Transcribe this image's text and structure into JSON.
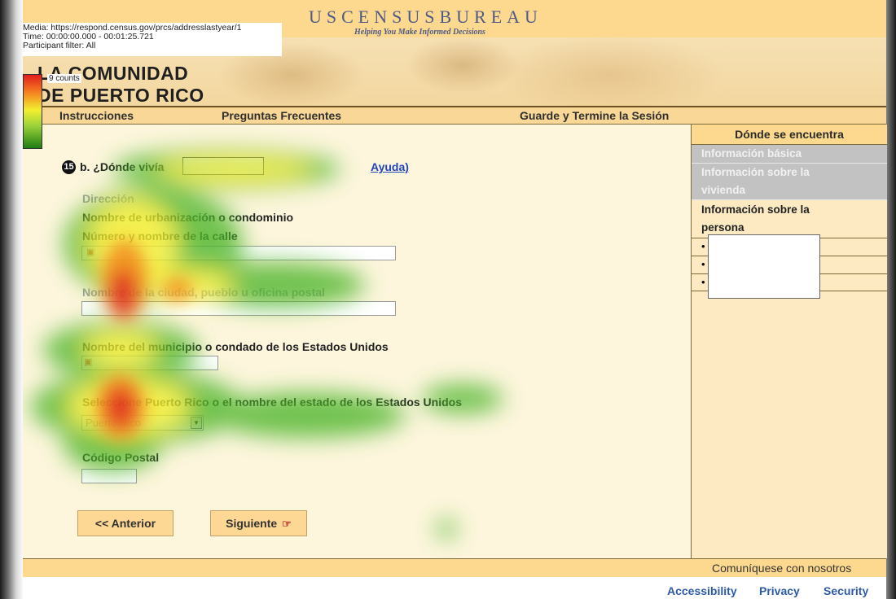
{
  "recording": {
    "media": "Media: https://respond.census.gov/prcs/addresslastyear/1",
    "time": "Time: 00:00:00.000 - 00:01:25.721",
    "filter": "Participant filter: All",
    "legend_count": "9 counts"
  },
  "header": {
    "logo_title": "USCENSUSBUREAU",
    "tagline": "Helping You Make Informed Decisions",
    "banner_line1": "LA COMUNIDAD",
    "banner_line2": "DE PUERTO RICO"
  },
  "nav": {
    "instrucciones": "Instrucciones",
    "preguntas": "Preguntas Frecuentes",
    "guarde": "Guarde y Termine la Sesión"
  },
  "sidebar": {
    "title": "Dónde se encuentra",
    "info_basica": "Información básica",
    "info_vivienda_1": "Información sobre la",
    "info_vivienda_2": "vivienda",
    "info_persona_1": "Información sobre la",
    "info_persona_2": "persona",
    "bullet": "•"
  },
  "question": {
    "number": "15",
    "text": "b. ¿Dónde vivía",
    "help": "Ayuda)"
  },
  "form": {
    "direccion_label": "Dirección",
    "urbanizacion_label": "Nombre de urbanización o condominio",
    "calle_label": "Número y nombre de la calle",
    "ciudad_label": "Nombre de la ciudad, pueblo u oficina postal",
    "municipio_label": "Nombre del municipio o condado de los Estados Unidos",
    "estado_label": "Seleccione Puerto Rico o el nombre del estado de los Estados Unidos",
    "estado_value": "Puerto Rico",
    "codigo_label": "Código Postal"
  },
  "buttons": {
    "anterior": "<<  Anterior",
    "siguiente": "Siguiente"
  },
  "footer": {
    "contact": "Comuníquese con nosotros",
    "accessibility": "Accessibility",
    "privacy": "Privacy",
    "security": "Security"
  },
  "colors": {
    "header_gold": "#fdd98f",
    "page_cream": "#fdf6dd",
    "sidebar_cream": "#fdeac3",
    "link_blue": "#2d5aa8",
    "heat_red": "#e01d1d",
    "heat_yellow": "#f3ef2f",
    "heat_green": "#4db52a"
  }
}
